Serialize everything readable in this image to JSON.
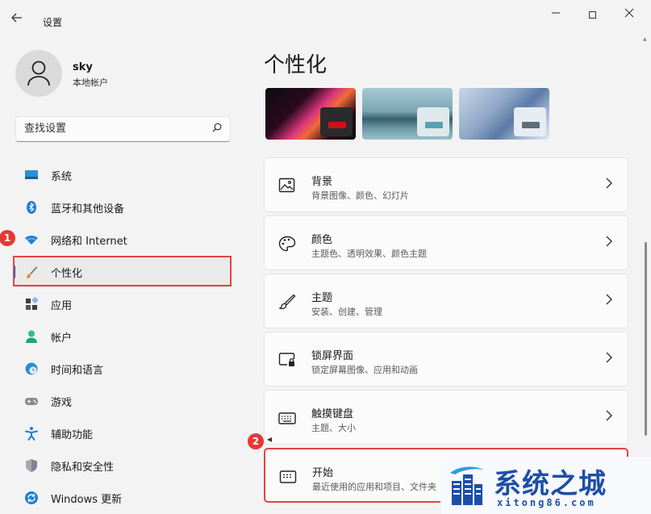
{
  "window": {
    "title": "设置",
    "back_icon": "back-arrow-icon",
    "minimize_icon": "minimize-icon",
    "maximize_icon": "maximize-icon",
    "close_icon": "close-icon"
  },
  "user": {
    "name": "sky",
    "account_type": "本地帐户"
  },
  "search": {
    "placeholder": "查找设置"
  },
  "nav": {
    "items": [
      {
        "label": "系统",
        "icon": "monitor-icon"
      },
      {
        "label": "蓝牙和其他设备",
        "icon": "bluetooth-icon"
      },
      {
        "label": "网络和 Internet",
        "icon": "wifi-icon"
      },
      {
        "label": "个性化",
        "icon": "paintbrush-icon",
        "active": true
      },
      {
        "label": "应用",
        "icon": "apps-icon"
      },
      {
        "label": "帐户",
        "icon": "account-icon"
      },
      {
        "label": "时间和语言",
        "icon": "clock-globe-icon"
      },
      {
        "label": "游戏",
        "icon": "gamepad-icon"
      },
      {
        "label": "辅助功能",
        "icon": "accessibility-icon"
      },
      {
        "label": "隐私和安全性",
        "icon": "shield-icon"
      },
      {
        "label": "Windows 更新",
        "icon": "update-icon"
      }
    ]
  },
  "annotations": {
    "badge1": "1",
    "badge2": "2"
  },
  "main": {
    "title": "个性化",
    "themes": [
      {
        "name": "theme-bloom-dark",
        "accent": "#d40f17"
      },
      {
        "name": "theme-lake",
        "accent": "#57a0b3"
      },
      {
        "name": "theme-bloom-light",
        "accent": "#5e6c7c"
      }
    ],
    "cards": [
      {
        "title": "背景",
        "subtitle": "背景图像、颜色、幻灯片",
        "icon": "picture-icon"
      },
      {
        "title": "颜色",
        "subtitle": "主题色、透明效果、颜色主题",
        "icon": "palette-icon"
      },
      {
        "title": "主题",
        "subtitle": "安装、创建、管理",
        "icon": "brush-icon"
      },
      {
        "title": "锁屏界面",
        "subtitle": "锁定屏幕图像、应用和动画",
        "icon": "lockscreen-icon"
      },
      {
        "title": "触摸键盘",
        "subtitle": "主题、大小",
        "icon": "keyboard-icon"
      },
      {
        "title": "开始",
        "subtitle": "最近使用的应用和项目、文件夹",
        "icon": "start-icon"
      }
    ]
  },
  "watermark": {
    "name": "系统之城",
    "url": "xitong86.com"
  },
  "colors": {
    "accent": "#005fb8",
    "highlight_red": "#e54347",
    "badge_red": "#e53935"
  }
}
